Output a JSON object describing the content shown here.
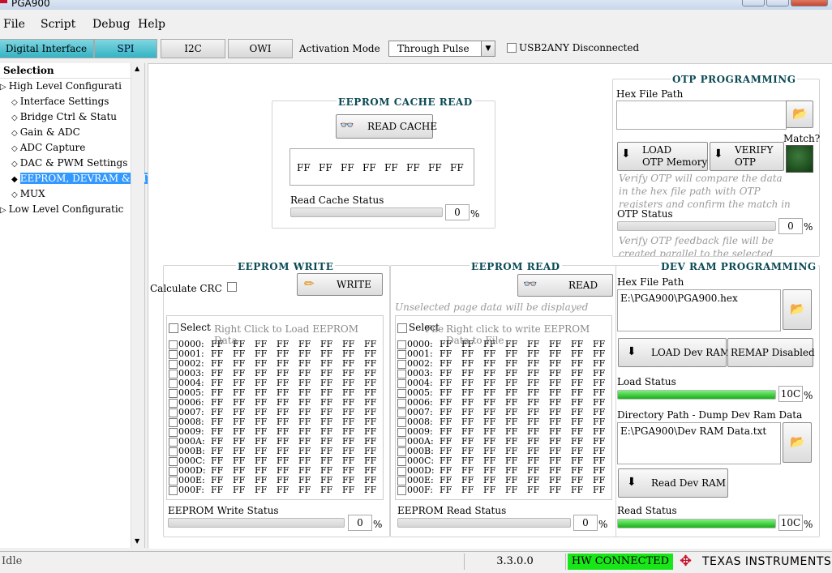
{
  "window": {
    "title": "PGA900"
  },
  "menu": [
    "File",
    "Script",
    "Debug",
    "Help"
  ],
  "interface_tabs": [
    "Digital Interface",
    "SPI",
    "I2C",
    "OWI"
  ],
  "activation": {
    "label": "Activation Mode",
    "value": "Through Pulse"
  },
  "usb2any": {
    "label": "USB2ANY Disconnected",
    "checked": false
  },
  "tree": {
    "header": "Selection",
    "items": [
      {
        "label": "High Level Configurati",
        "level": 0
      },
      {
        "label": "Interface Settings",
        "level": 1
      },
      {
        "label": "Bridge Ctrl & Statu",
        "level": 1
      },
      {
        "label": "Gain & ADC",
        "level": 1
      },
      {
        "label": "ADC Capture",
        "level": 1
      },
      {
        "label": "DAC & PWM Settings",
        "level": 1
      },
      {
        "label": "EEPROM, DEVRAM & OT",
        "level": 1,
        "selected": true
      },
      {
        "label": "MUX",
        "level": 1
      },
      {
        "label": "Low Level Configuratic",
        "level": 0
      }
    ]
  },
  "cache_read": {
    "title": "EEPROM CACHE READ",
    "button": "READ CACHE",
    "values": [
      "FF",
      "FF",
      "FF",
      "FF",
      "FF",
      "FF",
      "FF",
      "FF"
    ],
    "status_label": "Read Cache Status",
    "status_value": "0",
    "status_pct": "%"
  },
  "otp": {
    "title": "OTP PROGRAMMING",
    "hex_label": "Hex File Path",
    "hex_value": "",
    "match_label": "Match?",
    "load_button": [
      "LOAD",
      "OTP Memory"
    ],
    "verify_button": [
      "VERIFY",
      "OTP"
    ],
    "verify_hint": [
      "Verify OTP will compare the data",
      "in the  hex file path with  OTP",
      "registers and confirm the match in"
    ],
    "status_label": "OTP Status",
    "status_value": "0",
    "status_pct": "%",
    "feedback_hint": [
      "Verify OTP feedback file will be",
      "created parallel to the selected"
    ]
  },
  "eeprom_write": {
    "title": "EEPROM WRITE",
    "crc_label": "Calculate CRC",
    "button": "WRITE",
    "select_label": "Select",
    "hint": "Right Click to Load EEPROM Data",
    "status_label": "EEPROM Write Status",
    "status_value": "0",
    "status_pct": "%"
  },
  "eeprom_read": {
    "title": "EEPROM READ",
    "button": "READ",
    "hint_top": "Unselected page data will be displayed",
    "select_label": "Select",
    "overlap_label": "File",
    "hint": "Right click to write EEPROM Data to File",
    "status_label": "EEPROM Read Status",
    "status_value": "0",
    "status_pct": "%"
  },
  "eeprom_rows": {
    "addresses": [
      "0000:",
      "0001:",
      "0002:",
      "0003:",
      "0004:",
      "0005:",
      "0006:",
      "0007:",
      "0008:",
      "0009:",
      "000A:",
      "000B:",
      "000C:",
      "000D:",
      "000E:",
      "000F:"
    ],
    "cells": [
      "FF",
      "FF",
      "FF",
      "FF",
      "FF",
      "FF",
      "FF",
      "FF"
    ]
  },
  "devram": {
    "title": "DEV RAM PROGRAMMING",
    "hex_label": "Hex File Path",
    "hex_value": "E:\\PGA900\\PGA900.hex",
    "load_button": "LOAD Dev RAM",
    "remap_button": "REMAP Disabled",
    "load_status_label": "Load Status",
    "load_status_value": "10C",
    "load_progress": 1.0,
    "dir_label": "Directory Path - Dump Dev Ram Data",
    "dir_value": "E:\\PGA900\\Dev RAM Data.txt",
    "read_button": "Read Dev RAM",
    "read_status_label": "Read Status",
    "read_status_value": "10C",
    "read_progress": 1.0,
    "pct": "%"
  },
  "statusbar": {
    "state": "Idle",
    "version": "3.3.0.0",
    "hw": "HW CONNECTED",
    "brand": "TEXAS INSTRUMENTS"
  }
}
